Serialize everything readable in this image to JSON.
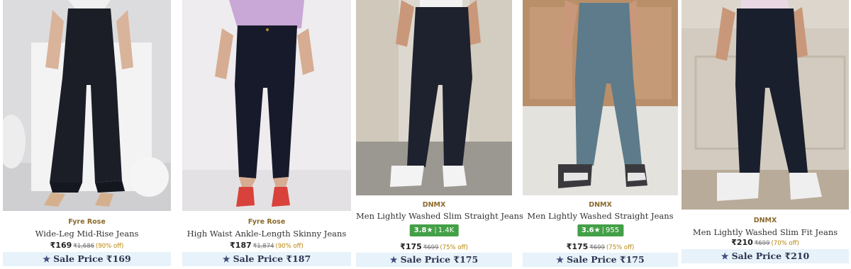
{
  "products": [
    {
      "brand": "Fyre Rose",
      "name": "Wide-Leg Mid-Rise Jeans",
      "price": "₹169",
      "mrp": "₹1,686",
      "discount": "(90% off)",
      "sale_label": "Sale Price ₹169",
      "image_icon": "woman-wide-leg-jeans-photo",
      "colors": {
        "bg": "#d9d9db",
        "jeans": "#1c1e27"
      }
    },
    {
      "brand": "Fyre Rose",
      "name": "High Waist Ankle-Length Skinny Jeans",
      "price": "₹187",
      "mrp": "₹1,874",
      "discount": "(90% off)",
      "sale_label": "Sale Price ₹187",
      "image_icon": "woman-skinny-jeans-photo",
      "colors": {
        "bg": "#eceaec",
        "jeans": "#171a2a"
      }
    },
    {
      "brand": "DNMX",
      "name": "Men Lightly Washed Slim Straight Jeans",
      "rating": {
        "score": "3.8",
        "star": "★",
        "count": "1.4K"
      },
      "price": "₹175",
      "mrp": "₹699",
      "discount": "(75% off)",
      "sale_label": "Sale Price ₹175",
      "image_icon": "man-slim-straight-jeans-photo",
      "colors": {
        "bg": "#d8d2c8",
        "jeans": "#1d222e"
      }
    },
    {
      "brand": "DNMX",
      "name": "Men Lightly Washed Straight Jeans",
      "rating": {
        "score": "3.6",
        "star": "★",
        "count": "955"
      },
      "price": "₹175",
      "mrp": "₹699",
      "discount": "(75% off)",
      "sale_label": "Sale Price ₹175",
      "image_icon": "man-light-wash-jeans-photo",
      "colors": {
        "bg": "#c9a987",
        "jeans": "#5d7b8a"
      }
    },
    {
      "brand": "DNMX",
      "name": "Men Lightly Washed Slim Fit Jeans",
      "price": "₹210",
      "mrp": "₹699",
      "discount": "(70% off)",
      "sale_label": "Sale Price ₹210",
      "image_icon": "man-slim-fit-jeans-photo",
      "colors": {
        "bg": "#ddd6cd",
        "jeans": "#1a1f2d"
      }
    }
  ],
  "sale_icon": "star-icon",
  "colors": {
    "rating_green": "#43a047",
    "sale_bar": "#e7f2fa",
    "brand_text": "#8b6a2c",
    "discount_text": "#b8860b"
  }
}
